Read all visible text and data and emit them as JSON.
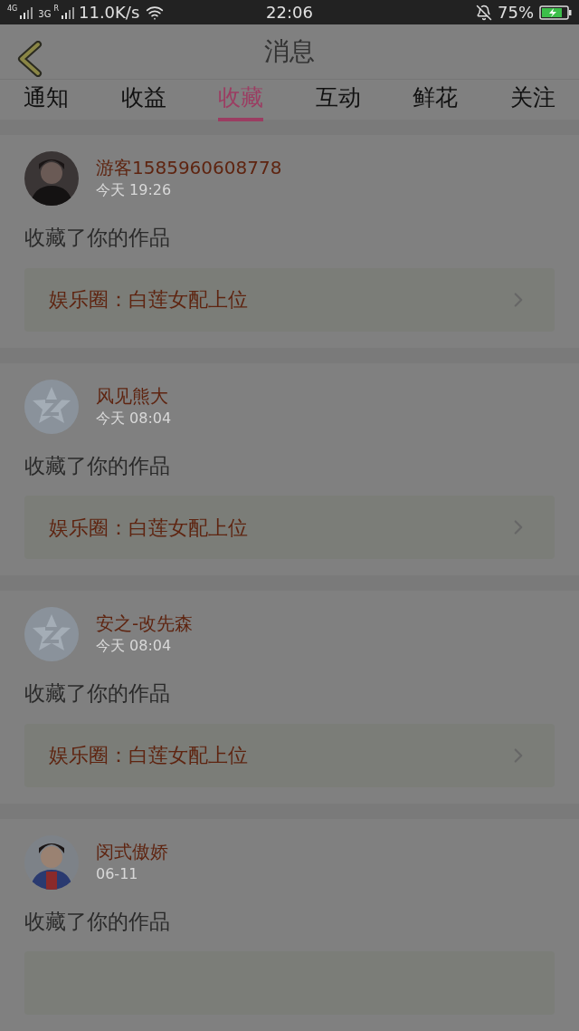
{
  "status_bar": {
    "sim1": "4G",
    "sim2": "3G",
    "roaming": "R",
    "speed": "11.0K/s",
    "time": "22:06",
    "battery": "75%"
  },
  "header": {
    "title": "消息"
  },
  "tabs": [
    {
      "label": "通知",
      "selected": false
    },
    {
      "label": "收益",
      "selected": false
    },
    {
      "label": "收藏",
      "selected": true
    },
    {
      "label": "互动",
      "selected": false
    },
    {
      "label": "鲜花",
      "selected": false
    },
    {
      "label": "关注",
      "selected": false
    }
  ],
  "messages": [
    {
      "name": "游客1585960608778",
      "time": "今天 19:26",
      "text": "收藏了你的作品",
      "link": "娱乐圈：白莲女配上位"
    },
    {
      "avatar": {
        "kind": "default"
      },
      "name": "风见熊大",
      "time": "今天 08:04",
      "text": "收藏了你的作品",
      "link": "娱乐圈：白莲女配上位"
    },
    {
      "avatar": {
        "kind": "default"
      },
      "name": "安之-改先森",
      "time": "今天 08:04",
      "text": "收藏了你的作品",
      "link": "娱乐圈：白莲女配上位"
    },
    {
      "avatar": {
        "kind": "photo2"
      },
      "name": "闵式傲娇",
      "time": "06-11",
      "text": "收藏了你的作品"
    }
  ]
}
